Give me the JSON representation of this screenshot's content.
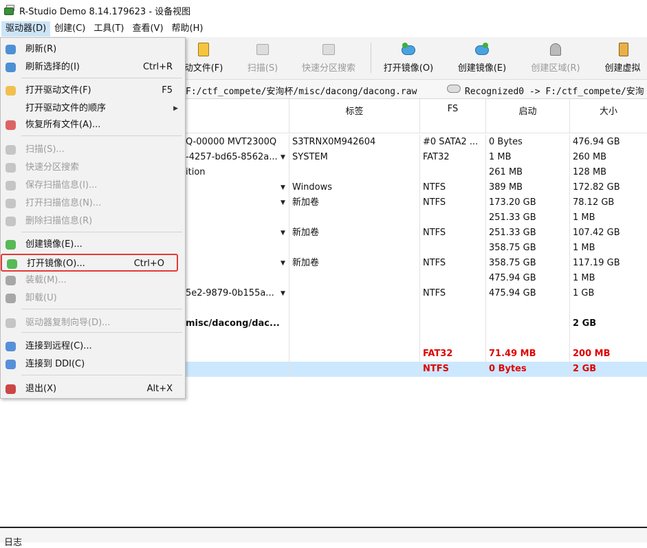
{
  "window": {
    "title": "R-Studio Demo 8.14.179623 - 设备视图"
  },
  "menubar": {
    "items": [
      "驱动器(D)",
      "创建(C)",
      "工具(T)",
      "查看(V)",
      "帮助(H)"
    ]
  },
  "toolbar": {
    "buttons": [
      {
        "label": "动文件(F)",
        "enabled": true
      },
      {
        "label": "扫描(S)",
        "enabled": false
      },
      {
        "label": "快速分区搜索",
        "enabled": false
      },
      {
        "label": "打开镜像(O)",
        "enabled": true
      },
      {
        "label": "创建镜像(E)",
        "enabled": true
      },
      {
        "label": "创建区域(R)",
        "enabled": false
      },
      {
        "label": "创建虚拟",
        "enabled": true
      }
    ]
  },
  "pathbar": {
    "path": "F:/ctf_compete/安洵杯/misc/dacong/dacong.raw",
    "recognized": "Recognized0 -> F:/ctf_compete/安洵"
  },
  "table": {
    "headers": [
      "标签",
      "FS",
      "启动",
      "大小"
    ],
    "rows": [
      {
        "name": "Q-00000 MVT2300Q",
        "label": "S3TRNX0M942604",
        "fs": "#0 SATA2 ...",
        "start": "0 Bytes",
        "size": "476.94 GB",
        "style": "normal",
        "dropdown": false
      },
      {
        "name": "-4257-bd65-8562a...",
        "label": "SYSTEM",
        "fs": "FAT32",
        "start": "1 MB",
        "size": "260 MB",
        "style": "normal",
        "dropdown": true
      },
      {
        "name": "ition",
        "label": "",
        "fs": "",
        "start": "261 MB",
        "size": "128 MB",
        "style": "normal",
        "dropdown": false
      },
      {
        "name": "",
        "label": "Windows",
        "fs": "NTFS",
        "start": "389 MB",
        "size": "172.82 GB",
        "style": "normal",
        "dropdown": true
      },
      {
        "name": "",
        "label": "新加卷",
        "fs": "NTFS",
        "start": "173.20 GB",
        "size": "78.12 GB",
        "style": "normal",
        "dropdown": true
      },
      {
        "name": "",
        "label": "",
        "fs": "",
        "start": "251.33 GB",
        "size": "1 MB",
        "style": "normal",
        "dropdown": false
      },
      {
        "name": "",
        "label": "新加卷",
        "fs": "NTFS",
        "start": "251.33 GB",
        "size": "107.42 GB",
        "style": "normal",
        "dropdown": true
      },
      {
        "name": "",
        "label": "",
        "fs": "",
        "start": "358.75 GB",
        "size": "1 MB",
        "style": "normal",
        "dropdown": false
      },
      {
        "name": "",
        "label": "新加卷",
        "fs": "NTFS",
        "start": "358.75 GB",
        "size": "117.19 GB",
        "style": "normal",
        "dropdown": true
      },
      {
        "name": "",
        "label": "",
        "fs": "",
        "start": "475.94 GB",
        "size": "1 MB",
        "style": "normal",
        "dropdown": false
      },
      {
        "name": "5e2-9879-0b155a...",
        "label": "",
        "fs": "NTFS",
        "start": "475.94 GB",
        "size": "1 GB",
        "style": "normal",
        "dropdown": true
      },
      {
        "name": "",
        "label": "",
        "fs": "",
        "start": "",
        "size": "",
        "style": "normal",
        "dropdown": false
      },
      {
        "name": "misc/dacong/dac...",
        "label": "",
        "fs": "",
        "start": "",
        "size": "2 GB",
        "style": "bold",
        "dropdown": false
      },
      {
        "name": "",
        "label": "",
        "fs": "",
        "start": "",
        "size": "",
        "style": "normal",
        "dropdown": false
      },
      {
        "name": "",
        "label": "",
        "fs": "FAT32",
        "start": "71.49 MB",
        "size": "200 MB",
        "style": "red",
        "dropdown": false
      },
      {
        "name": "",
        "label": "",
        "fs": "NTFS",
        "start": "0 Bytes",
        "size": "2 GB",
        "style": "red-selected",
        "dropdown": false
      }
    ]
  },
  "dropdown_menu": {
    "items": [
      {
        "label": "刷新(R)",
        "shortcut": "",
        "enabled": true,
        "icon": "refresh-icon"
      },
      {
        "label": "刷新选择的(I)",
        "shortcut": "Ctrl+R",
        "enabled": true,
        "icon": "refresh-selected-icon"
      },
      {
        "label": "打开驱动文件(F)",
        "shortcut": "F5",
        "enabled": true,
        "icon": "open-drive-files-icon"
      },
      {
        "label": "打开驱动文件的顺序",
        "shortcut": "",
        "enabled": true,
        "icon": "",
        "submenu": true
      },
      {
        "label": "恢复所有文件(A)...",
        "shortcut": "",
        "enabled": true,
        "icon": "recover-all-icon"
      },
      {
        "label": "扫描(S)...",
        "shortcut": "",
        "enabled": false,
        "icon": "scan-icon"
      },
      {
        "label": "快速分区搜索",
        "shortcut": "",
        "enabled": false,
        "icon": "quick-search-icon"
      },
      {
        "label": "保存扫描信息(I)...",
        "shortcut": "",
        "enabled": false,
        "icon": "save-scan-icon"
      },
      {
        "label": "打开扫描信息(N)...",
        "shortcut": "",
        "enabled": false,
        "icon": "open-scan-icon"
      },
      {
        "label": "删除扫描信息(R)",
        "shortcut": "",
        "enabled": false,
        "icon": "delete-scan-icon"
      },
      {
        "label": "创建镜像(E)...",
        "shortcut": "",
        "enabled": true,
        "icon": "create-image-icon"
      },
      {
        "label": "打开镜像(O)...",
        "shortcut": "Ctrl+O",
        "enabled": true,
        "icon": "open-image-icon",
        "highlighted": true
      },
      {
        "label": "装载(M)...",
        "shortcut": "",
        "enabled": false,
        "icon": "mount-icon"
      },
      {
        "label": "卸载(U)",
        "shortcut": "",
        "enabled": false,
        "icon": "unmount-icon"
      },
      {
        "label": "驱动器复制向导(D)...",
        "shortcut": "",
        "enabled": false,
        "icon": "copy-wizard-icon"
      },
      {
        "label": "连接到远程(C)...",
        "shortcut": "",
        "enabled": true,
        "icon": "connect-remote-icon"
      },
      {
        "label": "连接到 DDI(C)",
        "shortcut": "",
        "enabled": true,
        "icon": "connect-ddi-icon"
      },
      {
        "label": "退出(X)",
        "shortcut": "Alt+X",
        "enabled": true,
        "icon": "exit-icon"
      }
    ]
  },
  "bottom": {
    "log_label": "日志"
  },
  "colors": {
    "highlight_border": "#e53935",
    "selected_row": "#cce8ff",
    "red_text": "#e00000"
  }
}
